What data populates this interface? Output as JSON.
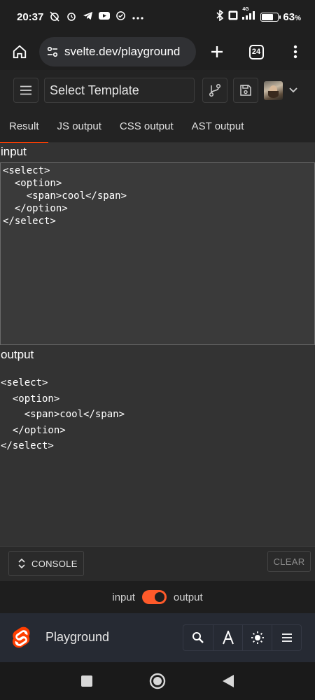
{
  "status_bar": {
    "time": "20:37",
    "battery_percent": "63",
    "battery_unit": "%",
    "battery_level": 0.63,
    "network_label": "4G"
  },
  "browser": {
    "url": "svelte.dev/playground",
    "tab_count": "24"
  },
  "app_header": {
    "template_label": "Select Template"
  },
  "tabs": [
    {
      "label": "Result",
      "active": true
    },
    {
      "label": "JS output",
      "active": false
    },
    {
      "label": "CSS output",
      "active": false
    },
    {
      "label": "AST output",
      "active": false
    }
  ],
  "input_section": {
    "label": "input",
    "code": "<select>\n  <option>\n    <span>cool</span>\n  </option>\n</select>"
  },
  "output_section": {
    "label": "output",
    "code": "<select>\n  <option>\n    <span>cool</span>\n  </option>\n</select>"
  },
  "console": {
    "console_label": "CONSOLE",
    "clear_label": "CLEAR"
  },
  "toggle": {
    "left_label": "input",
    "right_label": "output",
    "state": "output"
  },
  "bottom_nav": {
    "title": "Playground",
    "actions": [
      "search-icon",
      "font-icon",
      "theme-icon",
      "menu-icon"
    ]
  },
  "colors": {
    "accent": "#ff3e00",
    "toggle_on": "#ff5a2a",
    "panel_bg": "#333333"
  }
}
